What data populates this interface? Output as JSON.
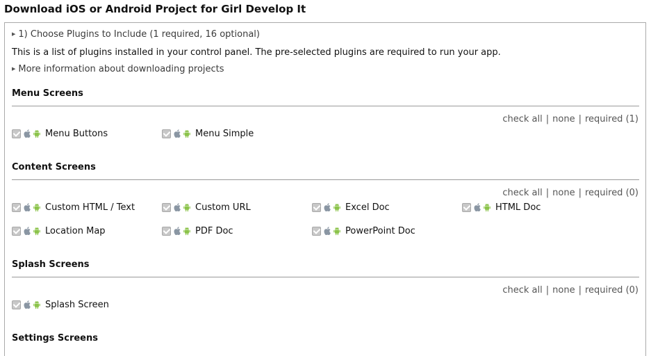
{
  "page": {
    "title": "Download iOS or Android Project for Girl Develop It"
  },
  "step": {
    "toggle_label": "1) Choose Plugins to Include (1 required, 16 optional)",
    "description": "This is a list of plugins installed in your control panel. The pre-selected plugins are required to run your app.",
    "more_info": "More information about downloading projects"
  },
  "controls": {
    "check_all": "check all",
    "none": "none",
    "separator": "|"
  },
  "sections": [
    {
      "title": "Menu Screens",
      "required": "required (1)",
      "plugins": [
        {
          "label": "Menu Buttons",
          "checked": true
        },
        {
          "label": "Menu Simple",
          "checked": true
        }
      ]
    },
    {
      "title": "Content Screens",
      "required": "required (0)",
      "plugins": [
        {
          "label": "Custom HTML / Text",
          "checked": true
        },
        {
          "label": "Custom URL",
          "checked": true
        },
        {
          "label": "Excel Doc",
          "checked": true
        },
        {
          "label": "HTML Doc",
          "checked": true
        },
        {
          "label": "Location Map",
          "checked": true
        },
        {
          "label": "PDF Doc",
          "checked": true
        },
        {
          "label": "PowerPoint Doc",
          "checked": true
        }
      ]
    },
    {
      "title": "Splash Screens",
      "required": "required (0)",
      "plugins": [
        {
          "label": "Splash Screen",
          "checked": true
        }
      ]
    },
    {
      "title": "Settings Screens",
      "required": "",
      "plugins": []
    }
  ],
  "icons": {
    "platform_ios": "apple-icon",
    "platform_android": "android-icon",
    "checkbox": "checkbox-checked"
  },
  "colors": {
    "android_green": "#8bc34a",
    "apple_gray": "#8a96a3",
    "control_text": "#555555",
    "rule": "#999999"
  }
}
